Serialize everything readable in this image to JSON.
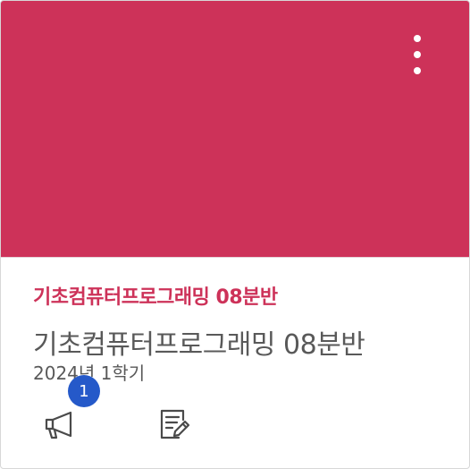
{
  "card": {
    "banner_color": "#cd3259",
    "menu_icon": "kebab-vertical-icon",
    "course_code": "기초컴퓨터프로그래밍 08분반",
    "course_name": "기초컴퓨터프로그래밍 08분반",
    "term": "2024년 1학기",
    "actions": {
      "announcements_icon": "megaphone-icon",
      "announcements_badge": "1",
      "badge_color": "#2559c9",
      "assignments_icon": "assignment-edit-icon"
    }
  }
}
